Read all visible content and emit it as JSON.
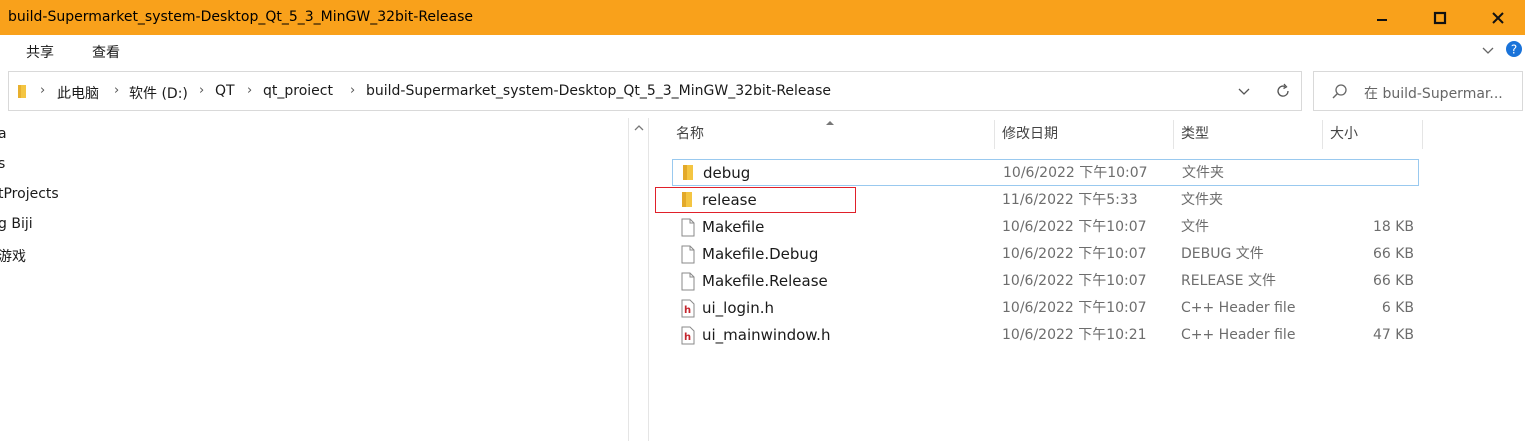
{
  "window": {
    "title": "build-Supermarket_system-Desktop_Qt_5_3_MinGW_32bit-Release"
  },
  "ribbon": {
    "tabs": [
      "共享",
      "查看"
    ]
  },
  "address_bar": {
    "crumbs": [
      "此电脑",
      "软件 (D:)",
      "QT",
      "qt_proiect",
      "build-Supermarket_system-Desktop_Qt_5_3_MinGW_32bit-Release"
    ]
  },
  "search": {
    "placeholder": "在 build-Supermar..."
  },
  "nav_pane": {
    "items": [
      "a",
      "s",
      "tProjects",
      "g Biji",
      "游戏"
    ]
  },
  "columns": {
    "name": "名称",
    "date": "修改日期",
    "type": "类型",
    "size": "大小"
  },
  "files": [
    {
      "name": "debug",
      "date": "10/6/2022 下午10:07",
      "type": "文件夹",
      "size": "",
      "icon": "folder-icon"
    },
    {
      "name": "release",
      "date": "11/6/2022 下午5:33",
      "type": "文件夹",
      "size": "",
      "icon": "folder-icon"
    },
    {
      "name": "Makefile",
      "date": "10/6/2022 下午10:07",
      "type": "文件",
      "size": "18 KB",
      "icon": "file-icon"
    },
    {
      "name": "Makefile.Debug",
      "date": "10/6/2022 下午10:07",
      "type": "DEBUG 文件",
      "size": "66 KB",
      "icon": "file-icon"
    },
    {
      "name": "Makefile.Release",
      "date": "10/6/2022 下午10:07",
      "type": "RELEASE 文件",
      "size": "66 KB",
      "icon": "file-icon"
    },
    {
      "name": "ui_login.h",
      "date": "10/6/2022 下午10:07",
      "type": "C++ Header file",
      "size": "6 KB",
      "icon": "header-file-icon"
    },
    {
      "name": "ui_mainwindow.h",
      "date": "10/6/2022 下午10:21",
      "type": "C++ Header file",
      "size": "47 KB",
      "icon": "header-file-icon"
    }
  ],
  "colors": {
    "titlebar": "#f9a11b",
    "selection_border": "#99c9ef",
    "highlight_box": "#e0202a",
    "folder": "#f4c542"
  }
}
